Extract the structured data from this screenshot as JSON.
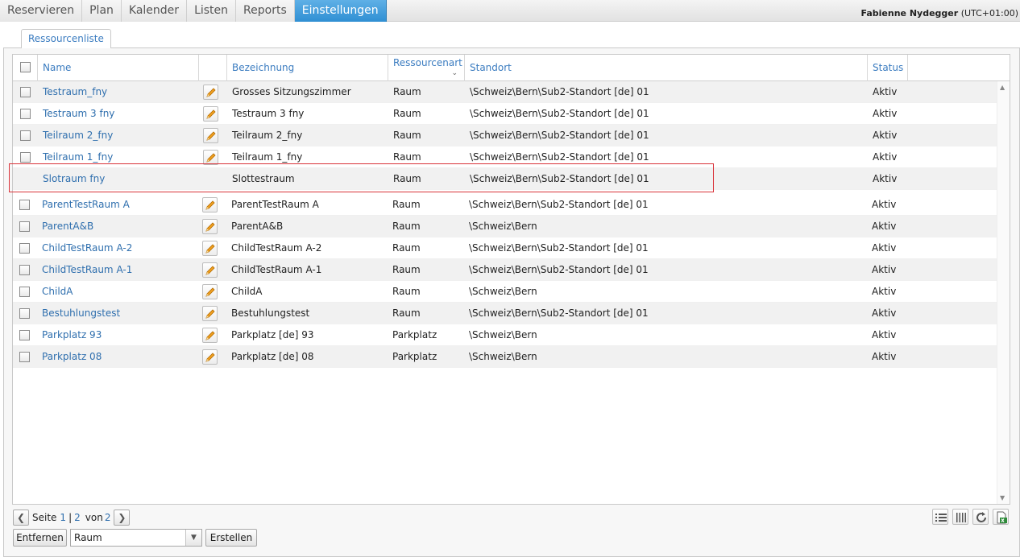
{
  "nav": {
    "tabs": [
      "Reservieren",
      "Plan",
      "Kalender",
      "Listen",
      "Reports",
      "Einstellungen"
    ],
    "active": "Einstellungen"
  },
  "user": {
    "name": "Fabienne Nydegger",
    "tz": "(UTC+01:00)"
  },
  "subtab": "Ressourcenliste",
  "columns": {
    "name": "Name",
    "bezeichnung": "Bezeichnung",
    "ressourcenart": "Ressourcenart",
    "standort": "Standort",
    "status": "Status"
  },
  "rows": [
    {
      "name": "Testraum_fny",
      "bez": "Grosses Sitzungszimmer",
      "art": "Raum",
      "ort": "\\Schweiz\\Bern\\Sub2-Standort [de] 01",
      "status": "Aktiv"
    },
    {
      "name": "Testraum 3 fny",
      "bez": "Testraum 3 fny",
      "art": "Raum",
      "ort": "\\Schweiz\\Bern\\Sub2-Standort [de] 01",
      "status": "Aktiv"
    },
    {
      "name": "Teilraum 2_fny",
      "bez": "Teilraum 2_fny",
      "art": "Raum",
      "ort": "\\Schweiz\\Bern\\Sub2-Standort [de] 01",
      "status": "Aktiv"
    },
    {
      "name": "Teilraum 1_fny",
      "bez": "Teilraum 1_fny",
      "art": "Raum",
      "ort": "\\Schweiz\\Bern\\Sub2-Standort [de] 01",
      "status": "Aktiv"
    },
    {
      "name": "Slotraum fny",
      "bez": "Slottestraum",
      "art": "Raum",
      "ort": "\\Schweiz\\Bern\\Sub2-Standort [de] 01",
      "status": "Aktiv"
    },
    {
      "name": "ParentTestRaum A",
      "bez": "ParentTestRaum A",
      "art": "Raum",
      "ort": "\\Schweiz\\Bern\\Sub2-Standort [de] 01",
      "status": "Aktiv"
    },
    {
      "name": "ParentA&B",
      "bez": "ParentA&B",
      "art": "Raum",
      "ort": "\\Schweiz\\Bern",
      "status": "Aktiv"
    },
    {
      "name": "ChildTestRaum A-2",
      "bez": "ChildTestRaum A-2",
      "art": "Raum",
      "ort": "\\Schweiz\\Bern\\Sub2-Standort [de] 01",
      "status": "Aktiv"
    },
    {
      "name": "ChildTestRaum A-1",
      "bez": "ChildTestRaum A-1",
      "art": "Raum",
      "ort": "\\Schweiz\\Bern\\Sub2-Standort [de] 01",
      "status": "Aktiv"
    },
    {
      "name": "ChildA",
      "bez": "ChildA",
      "art": "Raum",
      "ort": "\\Schweiz\\Bern",
      "status": "Aktiv"
    },
    {
      "name": "Bestuhlungstest",
      "bez": "Bestuhlungstest",
      "art": "Raum",
      "ort": "\\Schweiz\\Bern\\Sub2-Standort [de] 01",
      "status": "Aktiv"
    },
    {
      "name": "Parkplatz 93",
      "bez": "Parkplatz [de] 93",
      "art": "Parkplatz",
      "ort": "\\Schweiz\\Bern",
      "status": "Aktiv"
    },
    {
      "name": "Parkplatz 08",
      "bez": "Parkplatz [de] 08",
      "art": "Parkplatz",
      "ort": "\\Schweiz\\Bern",
      "status": "Aktiv"
    }
  ],
  "pager": {
    "seite": "Seite",
    "p1": "1",
    "sep": "|",
    "p2": "2",
    "von": "von",
    "total": "2"
  },
  "actions": {
    "remove": "Entfernen",
    "type_value": "Raum",
    "create": "Erstellen"
  },
  "colors": {
    "accent": "#3b7cc0",
    "active_tab": "#3a98db",
    "highlight": "#d9333a"
  }
}
